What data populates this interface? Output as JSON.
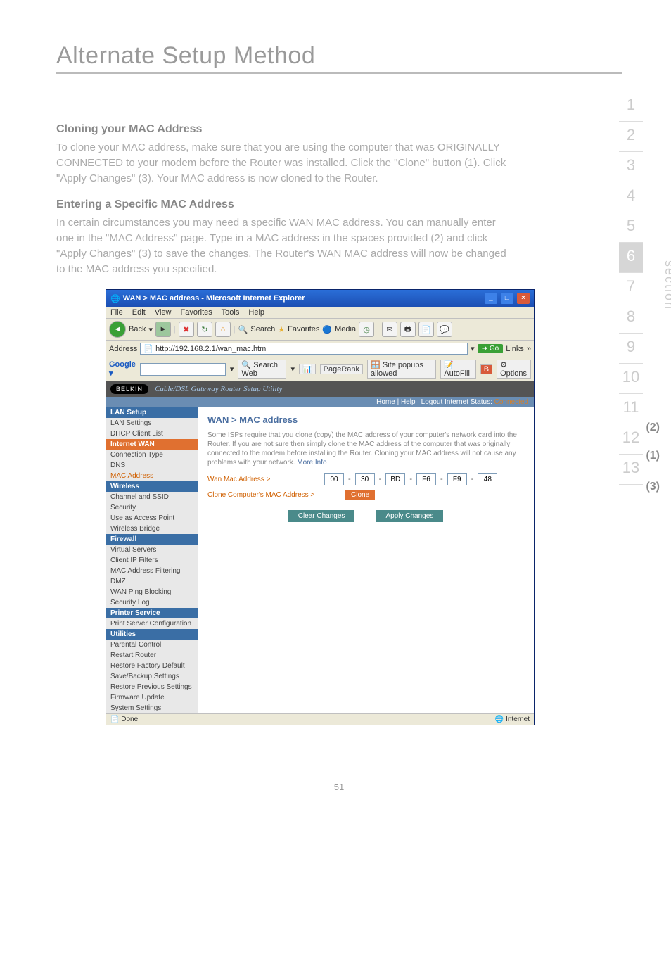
{
  "page_title": "Alternate Setup Method",
  "section1": {
    "heading": "Cloning your MAC Address",
    "body": "To clone your MAC address, make sure that you are using the computer that was ORIGINALLY CONNECTED to your modem before the Router was installed. Click the \"Clone\" button (1). Click \"Apply Changes\" (3). Your MAC address is now cloned to the Router."
  },
  "section2": {
    "heading": "Entering a Specific MAC Address",
    "body": "In certain circumstances you may need a specific WAN MAC address. You can manually enter one in the \"MAC Address\" page. Type in a MAC address in the spaces provided (2) and click \"Apply Changes\" (3) to save the changes. The Router's WAN MAC address will now be changed to the MAC address you specified."
  },
  "side_nav": {
    "items": [
      "1",
      "2",
      "3",
      "4",
      "5",
      "6",
      "7",
      "8",
      "9",
      "10",
      "11",
      "12",
      "13"
    ],
    "active": "6",
    "label": "section"
  },
  "callouts": {
    "c1": "(1)",
    "c2": "(2)",
    "c3": "(3)"
  },
  "ie": {
    "title": "WAN > MAC address - Microsoft Internet Explorer",
    "menu": [
      "File",
      "Edit",
      "View",
      "Favorites",
      "Tools",
      "Help"
    ],
    "toolbar": {
      "back": "Back",
      "search": "Search",
      "favorites": "Favorites",
      "media": "Media"
    },
    "address_label": "Address",
    "address_value": "http://192.168.2.1/wan_mac.html",
    "go": "Go",
    "links": "Links",
    "google": {
      "label": "Google ▾",
      "search_web": "Search Web",
      "pagerank": "PageRank",
      "popups": "Site popups allowed",
      "autofill": "AutoFill",
      "options": "Options"
    },
    "status_done": "Done",
    "status_zone": "Internet"
  },
  "belkin": {
    "brand": "BELKIN",
    "tagline": "Cable/DSL Gateway Router Setup Utility",
    "strip": "Home | Help | Logout   Internet Status:",
    "strip_status": "Connected",
    "nav": {
      "lan_setup": "LAN Setup",
      "lan_items": [
        "LAN Settings",
        "DHCP Client List"
      ],
      "internet_wan": "Internet WAN",
      "wan_items": [
        "Connection Type",
        "DNS",
        "MAC Address"
      ],
      "wireless": "Wireless",
      "wireless_items": [
        "Channel and SSID",
        "Security",
        "Use as Access Point",
        "Wireless Bridge"
      ],
      "firewall": "Firewall",
      "firewall_items": [
        "Virtual Servers",
        "Client IP Filters",
        "MAC Address Filtering",
        "DMZ",
        "WAN Ping Blocking",
        "Security Log"
      ],
      "printer": "Printer Service",
      "printer_items": [
        "Print Server Configuration"
      ],
      "utilities": "Utilities",
      "util_items": [
        "Parental Control",
        "Restart Router",
        "Restore Factory Default",
        "Save/Backup Settings",
        "Restore Previous Settings",
        "Firmware Update",
        "System Settings"
      ]
    },
    "main": {
      "heading": "WAN > MAC address",
      "desc": "Some ISPs require that you clone (copy) the MAC address of your computer's network card into the Router. If you are not sure then simply clone the MAC address of the computer that was originally connected to the modem before installing the Router. Cloning your MAC address will not cause any problems with your network.",
      "more_info": "More Info",
      "wan_mac_label": "Wan Mac Address >",
      "mac": [
        "00",
        "30",
        "BD",
        "F6",
        "F9",
        "48"
      ],
      "clone_label": "Clone Computer's MAC Address >",
      "clone_btn": "Clone",
      "clear": "Clear Changes",
      "apply": "Apply Changes"
    }
  },
  "page_number": "51"
}
